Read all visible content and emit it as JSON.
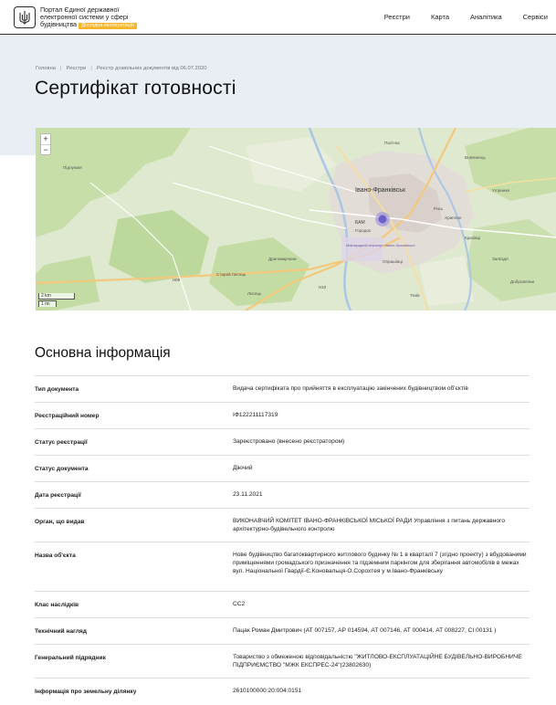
{
  "header": {
    "brand_line1": "Портал Єдиної державної",
    "brand_line2": "електронної системи у сфері",
    "brand_line3": "будівництва",
    "beta_badge": "Дослідна експлуатація",
    "nav": [
      "Реєстри",
      "Карта",
      "Аналітика",
      "Сервіси"
    ]
  },
  "breadcrumb": [
    "Головна",
    "Реєстри",
    "Реєстр дозвільних документів від 06.07.2020"
  ],
  "page_title": "Сертифікат готовності",
  "map": {
    "zoom_in": "+",
    "zoom_out": "−",
    "scale_km": "2 km",
    "scale_mi": "1 mi",
    "city_label": "Івано-Франківськ",
    "place_labels": [
      "Пасічна",
      "Вовчинець",
      "Хриплин",
      "БАМ",
      "Опришівці",
      "Драгомирчани",
      "Старий Лисець",
      "Лисець",
      "Угорники",
      "Рись",
      "Крихівці",
      "Загвіздя",
      "Підлужжя",
      "Тязів",
      "Добровляни",
      "Міжнародний аеропорт «Івано-Франківськ»",
      "Городок"
    ],
    "road_labels": [
      "H10",
      "H09"
    ],
    "colors": {
      "land": "#dfe9cf",
      "forest": "#b8d69a",
      "urban": "#e2ddd8",
      "water": "#aac6e6",
      "marker": "#6b5fc9"
    }
  },
  "main": {
    "section_title": "Основна інформація",
    "rows": [
      {
        "key": "Тип документа",
        "value": "Видача сертифіката про прийняття в експлуатацію закінчених будівництвом об'єктів"
      },
      {
        "key": "Реєстраційний номер",
        "value": "ІФ122211117319"
      },
      {
        "key": "Статус реєстрації",
        "value": "Зареєстровано (внесено реєстратором)"
      },
      {
        "key": "Статус документа",
        "value": "Діючий"
      },
      {
        "key": "Дата реєстрації",
        "value": "23.11.2021"
      },
      {
        "key": "Орган, що видав",
        "value": "ВИКОНАВЧИЙ КОМІТЕТ ІВАНО-ФРАНКІВСЬКОЇ МІСЬКОЇ РАДИ Управління з питань державного архітектурно-будівельного контролю"
      },
      {
        "key": "Назва об'єкта",
        "value": "Нове будівництво багатоквартирного житлового будинку № 1 в кварталі 7 (згідно проекту) з вбудованими приміщеннями громадського призначення та підземним паркінгом для зберігання автомобілів в межах вул. Національної Гвардії-Є.Коновальця-О.Сорохтея у м.Івано-Франківську"
      },
      {
        "key": "Клас наслідків",
        "value": "СС2"
      },
      {
        "key": "Технічний нагляд",
        "value": "Пацак Роман Дмитрович (АТ 007157, АР 014594, АТ 007146, АТ 000414, АТ 008227, СІ 00131 )"
      },
      {
        "key": "Генеральний підрядник",
        "value": "Товариство з обмеженою відповідальністю \"ЖИТЛОВО-ЕКСПЛУАТАЦІЙНЕ БУДІВЕЛЬНО-ВИРОБНИЧЕ ПІДПРИЄМСТВО \"МЖК ЕКСПРЕС-24\"(23802630)"
      },
      {
        "key": "Інформація про земельну ділянку",
        "value": "2610100000:20:004:0151"
      }
    ]
  }
}
